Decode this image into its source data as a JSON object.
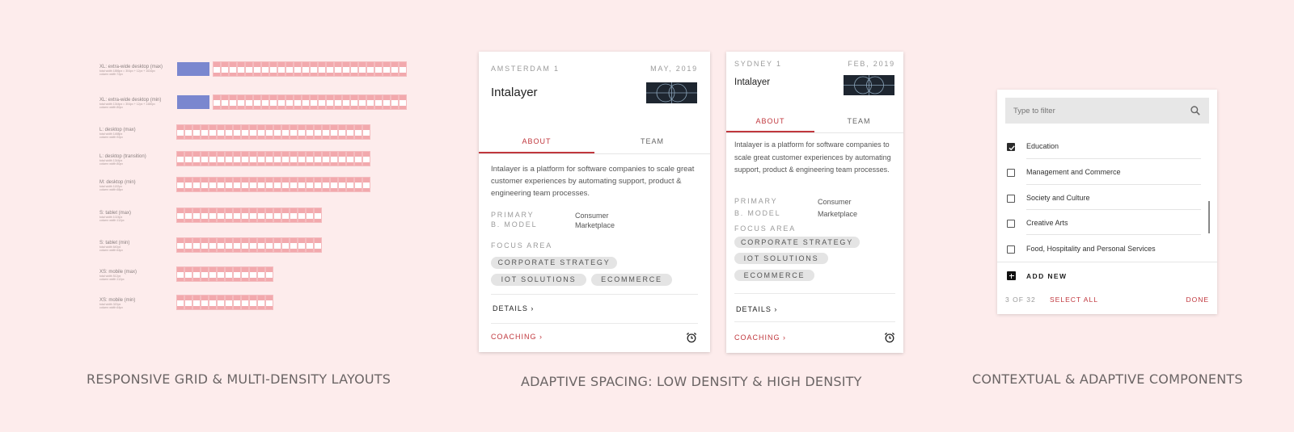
{
  "captions": {
    "grid": "RESPONSIVE GRID & MULTI-DENSITY LAYOUTS",
    "spacing": "ADAPTIVE SPACING: LOW DENSITY & HIGH DENSITY",
    "components": "CONTEXTUAL & ADAPTIVE COMPONENTS"
  },
  "breakpoints": [
    {
      "title": "XL: extra-wide desktop (max)",
      "sub1": "total width 1886px = 304px + 12px + 1634px",
      "sub2": "column width 72px",
      "columns": 8,
      "sidebar": true
    },
    {
      "title": "XL: extra-wide desktop (min)",
      "sub1": "total width 1344px = 304px + 12px + 1480px",
      "sub2": "column width 80px",
      "columns": 8,
      "sidebar": true
    },
    {
      "title": "L: desktop (max)",
      "sub1": "total width 1488px",
      "sub2": "column width 92px",
      "columns": 8,
      "sidebar": false
    },
    {
      "title": "L: desktop (transition)",
      "sub1": "total width 1344px",
      "sub2": "column width 80px",
      "columns": 8,
      "sidebar": false
    },
    {
      "title": "M: desktop (min)",
      "sub1": "total width 1192px",
      "sub2": "column width 68px",
      "columns": 8,
      "sidebar": false
    },
    {
      "title": "S: tablet (max)",
      "sub1": "total width 1024px",
      "sub2": "column width 112px",
      "columns": 6,
      "sidebar": false
    },
    {
      "title": "S: tablet (min)",
      "sub1": "total width 640px",
      "sub2": "column width 64px",
      "columns": 6,
      "sidebar": false
    },
    {
      "title": "XS: mobile (max)",
      "sub1": "total width 512px",
      "sub2": "column width 112px",
      "columns": 4,
      "sidebar": false
    },
    {
      "title": "XS: mobile (min)",
      "sub1": "total width 320px",
      "sub2": "column width 64px",
      "columns": 4,
      "sidebar": false
    }
  ],
  "card_low": {
    "location": "AMSTERDAM 1",
    "date": "MAY, 2019",
    "company": "Intalayer",
    "tab_about": "ABOUT",
    "tab_team": "TEAM",
    "description": "Intalayer is a platform for software companies to scale great customer experiences by automating support, product & engineering team processes.",
    "primary_label_1": "PRIMARY",
    "primary_label_2": "B. MODEL",
    "primary_value_1": "Consumer",
    "primary_value_2": "Marketplace",
    "focus_label": "FOCUS AREA",
    "chips": [
      "CORPORATE STRATEGY",
      "IOT SOLUTIONS",
      "ECOMMERCE"
    ],
    "details": "DETAILS ›",
    "coaching": "COACHING ›"
  },
  "card_high": {
    "location": "SYDNEY 1",
    "date": "FEB, 2019",
    "company": "Intalayer",
    "tab_about": "ABOUT",
    "tab_team": "TEAM",
    "description": "Intalayer is a platform for software companies to scale great customer experiences by automating support, product & engineering team processes.",
    "primary_label_1": "PRIMARY",
    "primary_label_2": "B. MODEL",
    "primary_value_1": "Consumer",
    "primary_value_2": "Marketplace",
    "focus_label": "FOCUS AREA",
    "chips": [
      "CORPORATE STRATEGY",
      "IOT SOLUTIONS",
      "ECOMMERCE"
    ],
    "details": "DETAILS ›",
    "coaching": "COACHING ›"
  },
  "filter": {
    "placeholder": "Type to filter",
    "items": [
      {
        "label": "Education",
        "checked": true
      },
      {
        "label": "Management and Commerce",
        "checked": false
      },
      {
        "label": "Society and Culture",
        "checked": false
      },
      {
        "label": "Creative Arts",
        "checked": false
      },
      {
        "label": "Food, Hospitality and Personal Services",
        "checked": false
      }
    ],
    "add_new": "ADD NEW",
    "count": "3 OF 32",
    "select_all": "SELECT ALL",
    "done": "DONE"
  },
  "icons": {
    "search": "search-icon",
    "alarm": "alarm-clock-icon",
    "check": "check-icon",
    "plus": "plus-square-icon"
  },
  "colors": {
    "background": "#fdecec",
    "accent": "#c0373d",
    "grid_margin": "#7a87cf",
    "grid_column": "#f2a9ad"
  }
}
